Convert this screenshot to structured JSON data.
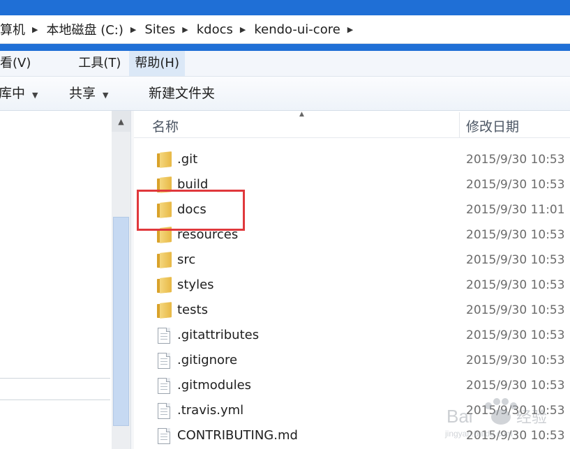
{
  "address_bar": {
    "crumbs": [
      "算机",
      "本地磁盘 (C:)",
      "Sites",
      "kdocs",
      "kendo-ui-core"
    ]
  },
  "menu_bar": {
    "items": [
      "看(V)",
      "工具(T)",
      "帮助(H)"
    ],
    "active": "帮助(H)"
  },
  "toolbar": {
    "include_label": "库中",
    "share_label": "共享",
    "new_folder_label": "新建文件夹"
  },
  "file_list": {
    "columns": {
      "name": "名称",
      "date_modified": "修改日期"
    },
    "rows": [
      {
        "name": ".git",
        "date": "2015/9/30 10:53",
        "icon": "folder-icon"
      },
      {
        "name": "build",
        "date": "2015/9/30 10:53",
        "icon": "folder-icon"
      },
      {
        "name": "docs",
        "date": "2015/9/30 11:01",
        "icon": "folder-icon"
      },
      {
        "name": "resources",
        "date": "2015/9/30 10:53",
        "icon": "folder-icon"
      },
      {
        "name": "src",
        "date": "2015/9/30 10:53",
        "icon": "folder-icon"
      },
      {
        "name": "styles",
        "date": "2015/9/30 10:53",
        "icon": "folder-icon"
      },
      {
        "name": "tests",
        "date": "2015/9/30 10:53",
        "icon": "folder-icon"
      },
      {
        "name": ".gitattributes",
        "date": "2015/9/30 10:53",
        "icon": "document-icon"
      },
      {
        "name": ".gitignore",
        "date": "2015/9/30 10:53",
        "icon": "document-icon"
      },
      {
        "name": ".gitmodules",
        "date": "2015/9/30 10:53",
        "icon": "document-icon"
      },
      {
        "name": ".travis.yml",
        "date": "2015/9/30 10:53",
        "icon": "document-icon"
      },
      {
        "name": "CONTRIBUTING.md",
        "date": "2015/9/30 10:53",
        "icon": "document-icon"
      }
    ]
  },
  "annotation": {
    "highlight_color": "#e0383c",
    "highlighted_item": "docs"
  },
  "colors": {
    "window_frame": "#1f6fd6",
    "menu_active": "#dbe8f7",
    "scroll_thumb": "#c6d9f2"
  },
  "watermark": {
    "text": "Baidu 经验",
    "subtext": "jingyan.baidu.com"
  }
}
